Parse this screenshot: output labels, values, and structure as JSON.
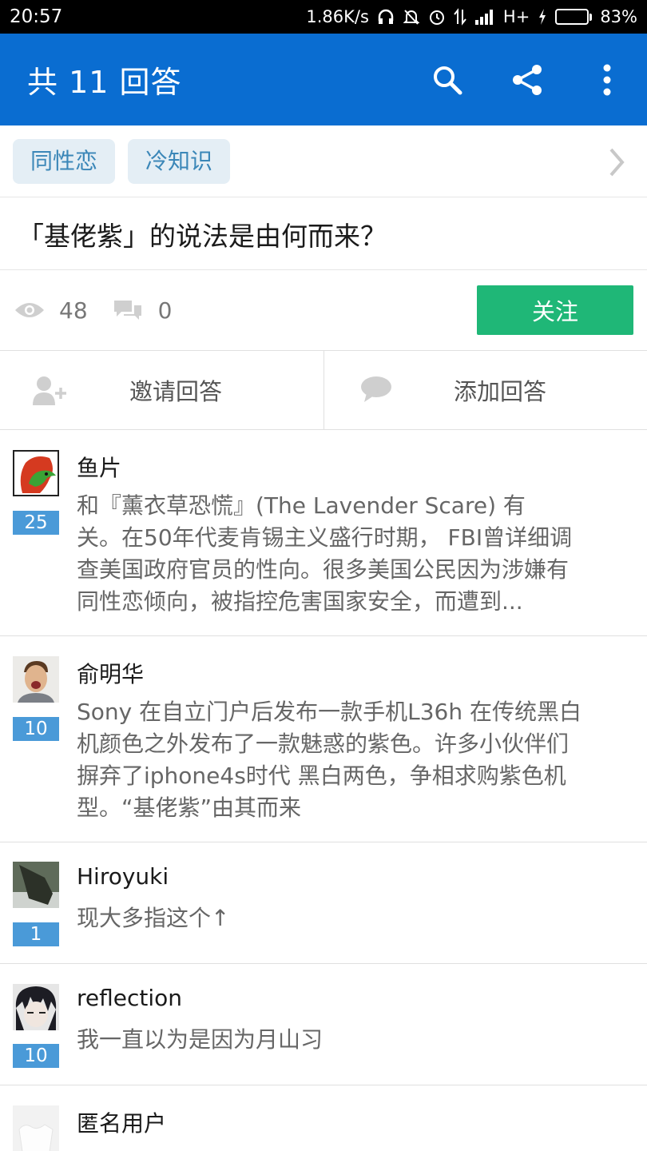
{
  "status_bar": {
    "time": "20:57",
    "speed": "1.86K/s",
    "network": "H+",
    "battery_pct": "83%",
    "battery_level": 0.83,
    "icons": [
      "headphones-icon",
      "mute-bell-icon",
      "alarm-icon",
      "signal-updown-icon",
      "signal-bars-icon",
      "charging-icon"
    ]
  },
  "app_bar": {
    "title": "共 11 回答",
    "actions": [
      "search-icon",
      "share-icon",
      "more-vert-icon"
    ],
    "color": "#0a6dd1"
  },
  "tags": [
    "同性恋",
    "冷知识"
  ],
  "question": {
    "title": "「基佬紫」的说法是由何而来？"
  },
  "stats": {
    "views": "48",
    "comments": "0",
    "follow_label": "关注",
    "follow_color": "#1fb777"
  },
  "actions": {
    "invite_label": "邀请回答",
    "add_label": "添加回答"
  },
  "answers": [
    {
      "author": "鱼片",
      "votes": "25",
      "lines": [
        "和『薰衣草恐慌』(The Lavender Scare) 有",
        "关。在50年代麦肯锡主义盛行时期， FBI曾详细调",
        "查美国政府官员的性向。很多美国公民因为涉嫌有",
        "同性恋倾向，被指控危害国家安全，而遭到..."
      ]
    },
    {
      "author": "俞明华",
      "votes": "10",
      "lines": [
        "Sony 在自立门户后发布一款手机L36h 在传统黑白",
        "机颜色之外发布了一款魅惑的紫色。许多小伙伴们",
        "摒弃了iphone4s时代 黑白两色，争相求购紫色机",
        "型。“基佬紫”由其而来"
      ]
    },
    {
      "author": "Hiroyuki",
      "votes": "1",
      "lines": [
        "现大多指这个↑"
      ]
    },
    {
      "author": "reflection",
      "votes": "10",
      "lines": [
        "我一直以为是因为月山习"
      ]
    },
    {
      "author": "匿名用户",
      "votes": "",
      "lines": []
    }
  ]
}
